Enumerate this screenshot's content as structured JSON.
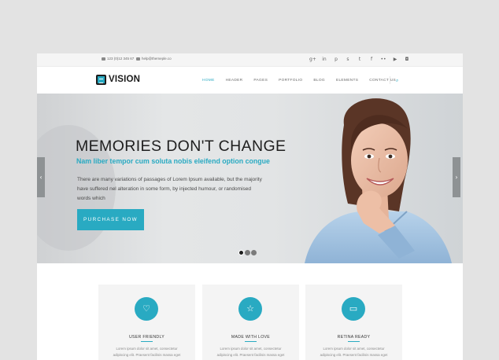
{
  "topbar": {
    "phone": "123 (0)12 345 67",
    "email": "help@themeple.co",
    "social": [
      {
        "icon": "google-plus-icon",
        "glyph": "g+"
      },
      {
        "icon": "linkedin-icon",
        "glyph": "in"
      },
      {
        "icon": "pinterest-icon",
        "glyph": "p"
      },
      {
        "icon": "skype-icon",
        "glyph": "s"
      },
      {
        "icon": "twitter-icon",
        "glyph": "t"
      },
      {
        "icon": "facebook-icon",
        "glyph": "f"
      },
      {
        "icon": "flickr-icon",
        "glyph": "••"
      },
      {
        "icon": "youtube-icon",
        "glyph": "▶"
      },
      {
        "icon": "instagram-icon",
        "glyph": "◘"
      }
    ]
  },
  "header": {
    "logo": "VISION",
    "nav": [
      "HOME",
      "HEADER",
      "PAGES",
      "PORTFOLIO",
      "BLOG",
      "ELEMENTS",
      "CONTACT US"
    ],
    "active": "HOME"
  },
  "hero": {
    "title": "MEMORIES DON'T CHANGE",
    "subtitle": "Nam liber tempor cum soluta nobis eleifend option congue",
    "text": "There are many variations of passages of Lorem Ipsum available, but the majority have suffered nel alteration in some form, by injected humour, or randomised words which",
    "button": "PURCHASE NOW",
    "prev": "‹",
    "next": "›",
    "slides": 3,
    "active_slide": 1
  },
  "features": [
    {
      "icon": "heart-icon",
      "glyph": "♡",
      "title": "USER FRIENDLY",
      "text": "Lorem ipsum dolor sit amet, consectetur adipiscing elit. Praesent facilisis massa eget"
    },
    {
      "icon": "star-icon",
      "glyph": "☆",
      "title": "MADE WITH LOVE",
      "text": "Lorem ipsum dolor sit amet, consectetur adipiscing elit. Praesent facilisis massa eget"
    },
    {
      "icon": "monitor-icon",
      "glyph": "▭",
      "title": "RETINA READY",
      "text": "Lorem ipsum dolor sit amet, consectetur adipiscing elit. Praesent facilisis massa eget"
    }
  ],
  "colors": {
    "accent": "#29aac2",
    "dark": "#1e1e1e"
  }
}
